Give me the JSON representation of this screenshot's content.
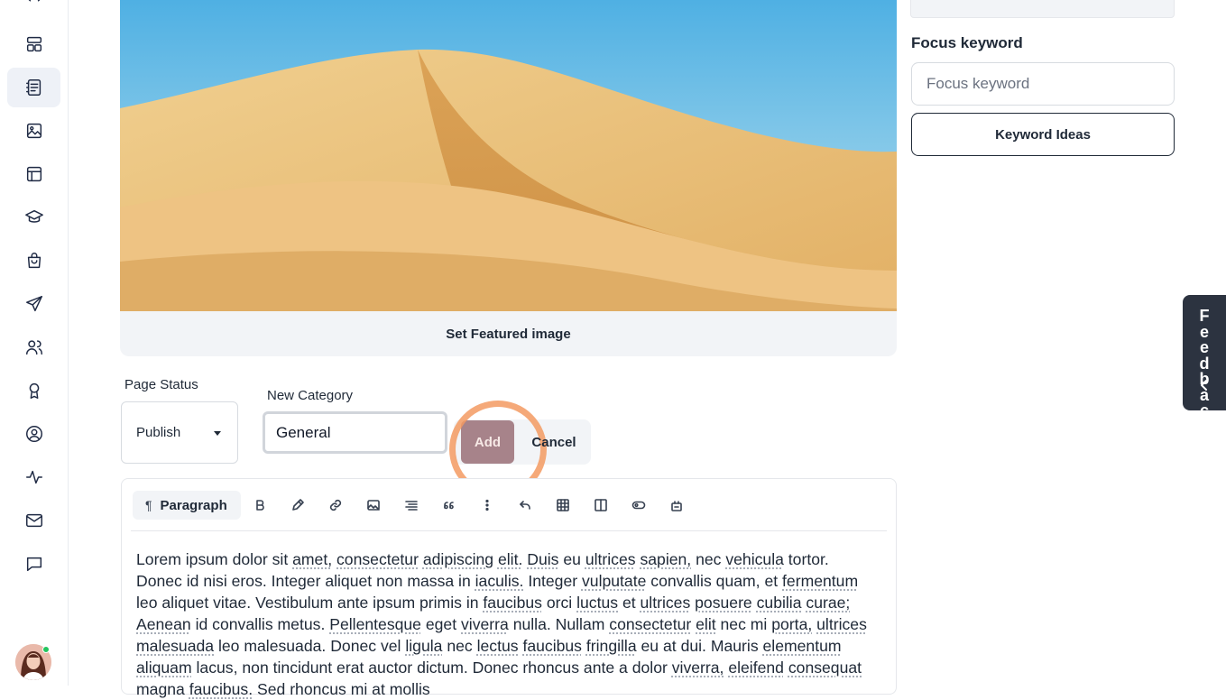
{
  "sidebar": {
    "items": [
      {
        "name": "dashboard-icon"
      },
      {
        "name": "pages-icon",
        "active": true
      },
      {
        "name": "media-icon"
      },
      {
        "name": "templates-icon"
      },
      {
        "name": "courses-icon"
      },
      {
        "name": "shop-icon"
      },
      {
        "name": "send-icon"
      },
      {
        "name": "users-icon"
      },
      {
        "name": "badge-icon"
      },
      {
        "name": "profile-icon"
      },
      {
        "name": "activity-icon"
      },
      {
        "name": "mail-icon"
      },
      {
        "name": "chat-icon"
      }
    ],
    "user_status": "online"
  },
  "featured_image": {
    "button_label": "Set Featured image"
  },
  "page_status": {
    "label": "Page Status",
    "selected": "Publish"
  },
  "new_category": {
    "label": "New Category",
    "value": "General",
    "add_label": "Add",
    "cancel_label": "Cancel"
  },
  "editor": {
    "block_type": "Paragraph",
    "tools": [
      "bold-icon",
      "highlighter-icon",
      "link-icon",
      "image-icon",
      "align-icon",
      "quote-icon",
      "more-icon",
      "undo-icon",
      "table-icon",
      "columns-icon",
      "tag-icon",
      "plugin-icon"
    ],
    "body": "Lorem ipsum dolor sit amet, consectetur adipiscing elit. Duis eu ultrices sapien, nec vehicula tortor. Donec id nisi eros. Integer aliquet non massa in iaculis. Integer vulputate convallis quam, et fermentum leo aliquet vitae. Vestibulum ante ipsum primis in faucibus orci luctus et ultrices posuere cubilia curae; Aenean id convallis metus. Pellentesque eget viverra nulla. Nullam consectetur elit nec mi porta, ultrices malesuada leo malesuada. Donec vel ligula nec lectus faucibus fringilla eu at dui. Mauris elementum aliquam lacus, non tincidunt erat auctor dictum. Donec rhoncus ante a dolor viverra, eleifend consequat magna faucibus. Sed rhoncus mi at mollis"
  },
  "seo": {
    "focus_keyword_label": "Focus keyword",
    "focus_keyword_placeholder": "Focus keyword",
    "keyword_ideas_label": "Keyword Ideas"
  },
  "feedback_tab": {
    "label": "Feedback"
  },
  "colors": {
    "accent_add": "#a7838a",
    "focus_ring": "#f39a62",
    "feedback_bg": "#2c3340"
  }
}
